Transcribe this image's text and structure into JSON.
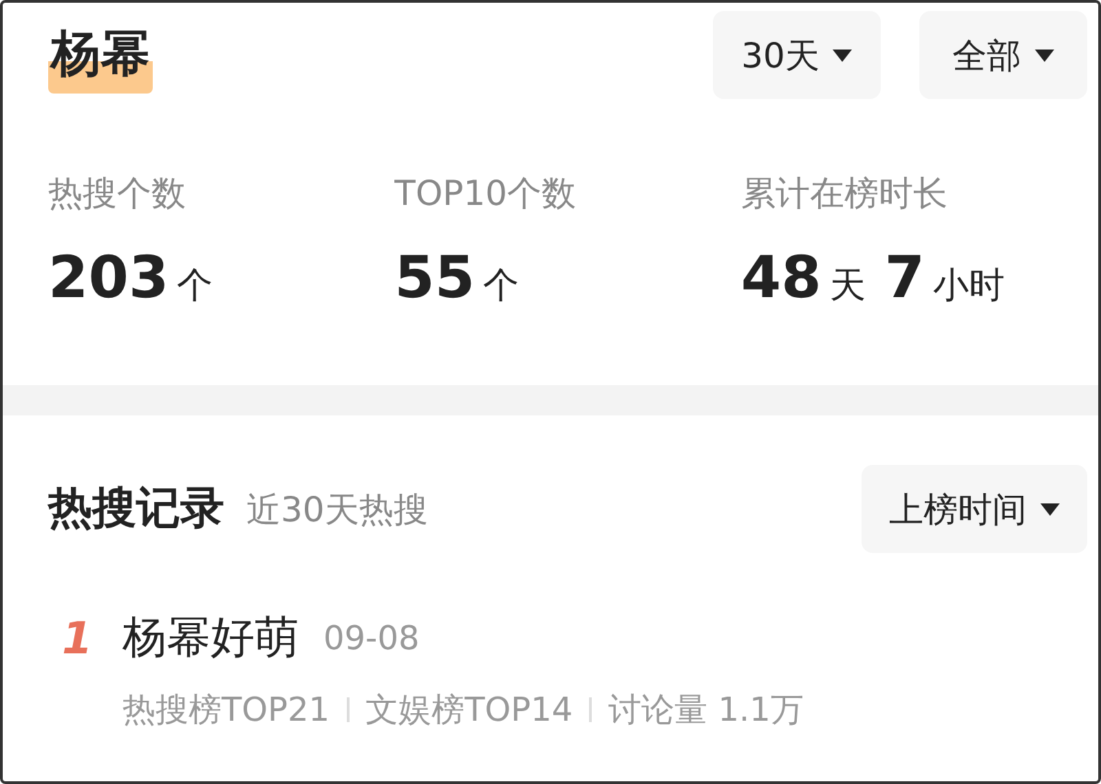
{
  "person": {
    "name": "杨幂"
  },
  "filters": [
    {
      "label": "30天"
    },
    {
      "label": "全部"
    }
  ],
  "stats": [
    {
      "label": "热搜个数",
      "parts": [
        {
          "value": "203",
          "unit": "个"
        }
      ]
    },
    {
      "label": "TOP10个数",
      "parts": [
        {
          "value": "55",
          "unit": "个"
        }
      ]
    },
    {
      "label": "累计在榜时长",
      "parts": [
        {
          "value": "48",
          "unit": "天"
        },
        {
          "value": "7",
          "unit": "小时"
        }
      ]
    }
  ],
  "records": {
    "title": "热搜记录",
    "subtitle": "近30天热搜",
    "sort": {
      "label": "上榜时间"
    },
    "items": [
      {
        "rank": "1",
        "title": "杨幂好萌",
        "date": "09-08",
        "tags": [
          "热搜榜TOP21",
          "文娱榜TOP14",
          "讨论量 1.1万"
        ]
      }
    ]
  }
}
